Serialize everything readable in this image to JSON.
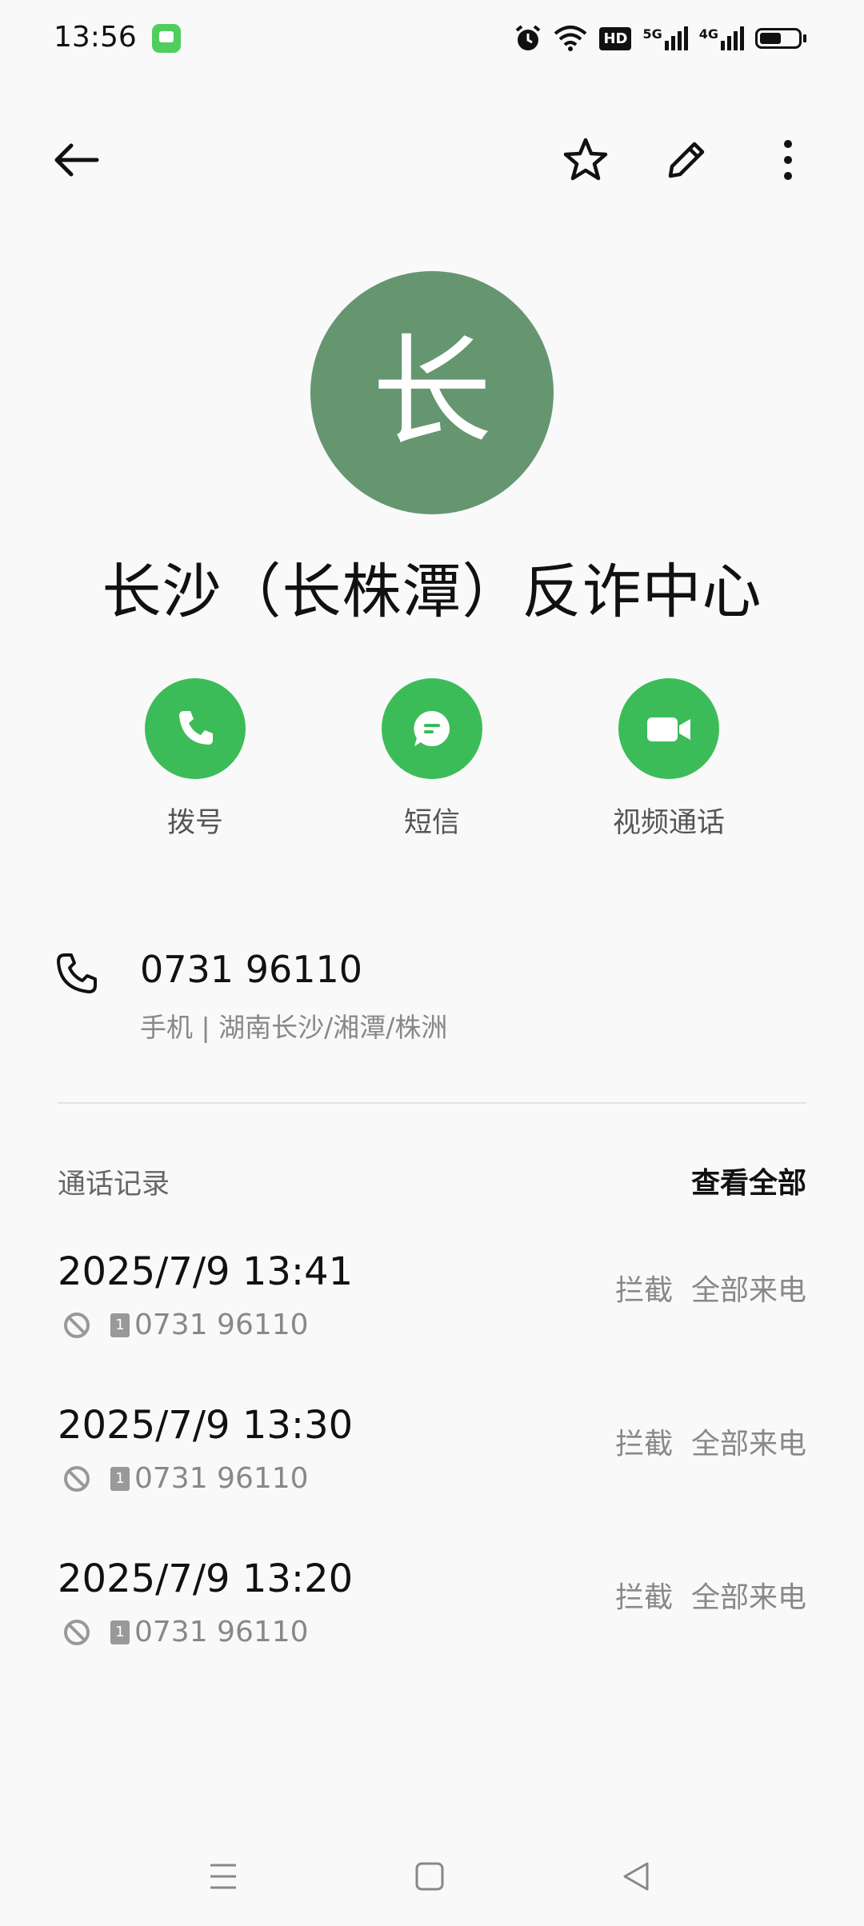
{
  "status_bar": {
    "time": "13:56",
    "icons": [
      "message-app-icon",
      "alarm-icon",
      "wifi-icon",
      "hd-icon",
      "signal-5g-icon",
      "signal-4g-icon",
      "battery-icon"
    ],
    "hd_label": "HD",
    "net1": "5G",
    "net2": "4G"
  },
  "toolbar": {
    "back_icon": "back-arrow-icon",
    "favorite_icon": "star-icon",
    "edit_icon": "pencil-icon",
    "more_icon": "more-vertical-icon"
  },
  "contact": {
    "avatar_letter": "长",
    "avatar_color": "#659670",
    "name": "长沙（长株潭）反诈中心"
  },
  "actions": [
    {
      "label": "拨号",
      "icon": "phone-icon"
    },
    {
      "label": "短信",
      "icon": "message-icon"
    },
    {
      "label": "视频通话",
      "icon": "video-icon"
    }
  ],
  "accent_color": "#3cbc58",
  "phone": {
    "number": "0731 96110",
    "meta": "手机 | 湖南长沙/湘潭/株洲"
  },
  "call_log": {
    "title": "通话记录",
    "view_all": "查看全部",
    "entries": [
      {
        "datetime": "2025/7/9 13:41",
        "number": "0731 96110",
        "status": "拦截  全部来电",
        "sim": "1"
      },
      {
        "datetime": "2025/7/9 13:30",
        "number": "0731 96110",
        "status": "拦截  全部来电",
        "sim": "1"
      },
      {
        "datetime": "2025/7/9 13:20",
        "number": "0731 96110",
        "status": "拦截  全部来电",
        "sim": "1"
      }
    ]
  },
  "nav_bar": [
    "menu-icon",
    "home-icon",
    "back-triangle-icon"
  ]
}
